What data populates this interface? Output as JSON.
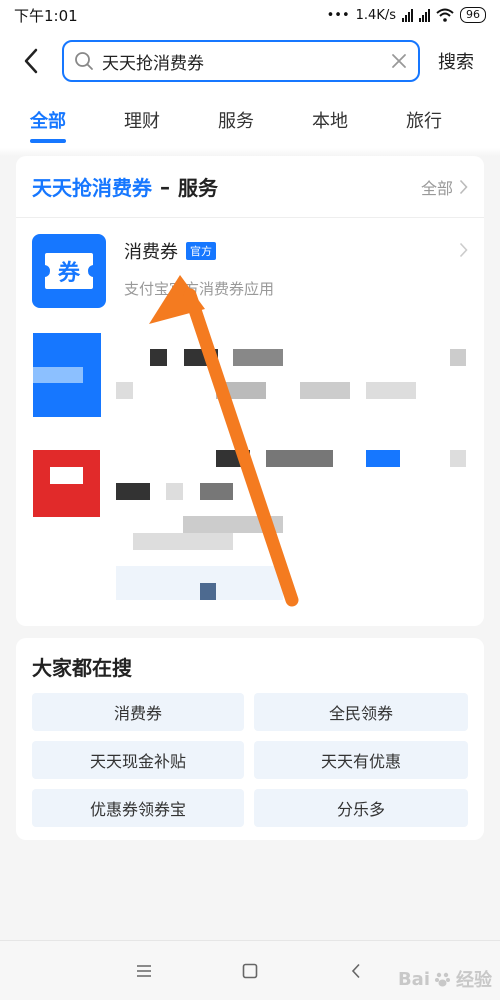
{
  "status": {
    "time": "下午1:01",
    "net_speed": "1.4K/s",
    "battery": "96"
  },
  "search": {
    "query": "天天抢消费券",
    "search_label": "搜索"
  },
  "tabs": [
    {
      "label": "全部"
    },
    {
      "label": "理财"
    },
    {
      "label": "服务"
    },
    {
      "label": "本地"
    },
    {
      "label": "旅行"
    }
  ],
  "service_card": {
    "keyword": "天天抢消费券",
    "separator": "–",
    "category": "服务",
    "all_label": "全部",
    "app": {
      "icon_char": "券",
      "name": "消费券",
      "badge": "官方",
      "desc": "支付宝官方消费券应用"
    }
  },
  "popular": {
    "title": "大家都在搜",
    "items": [
      {
        "label": "消费券"
      },
      {
        "label": "全民领券"
      },
      {
        "label": "天天现金补贴"
      },
      {
        "label": "天天有优惠"
      },
      {
        "label": "优惠券领券宝"
      },
      {
        "label": "分乐多"
      }
    ]
  },
  "watermark": {
    "text": "Bai",
    "suffix": "经验"
  },
  "colors": {
    "accent": "#1677ff",
    "arrow": "#f47b20"
  }
}
